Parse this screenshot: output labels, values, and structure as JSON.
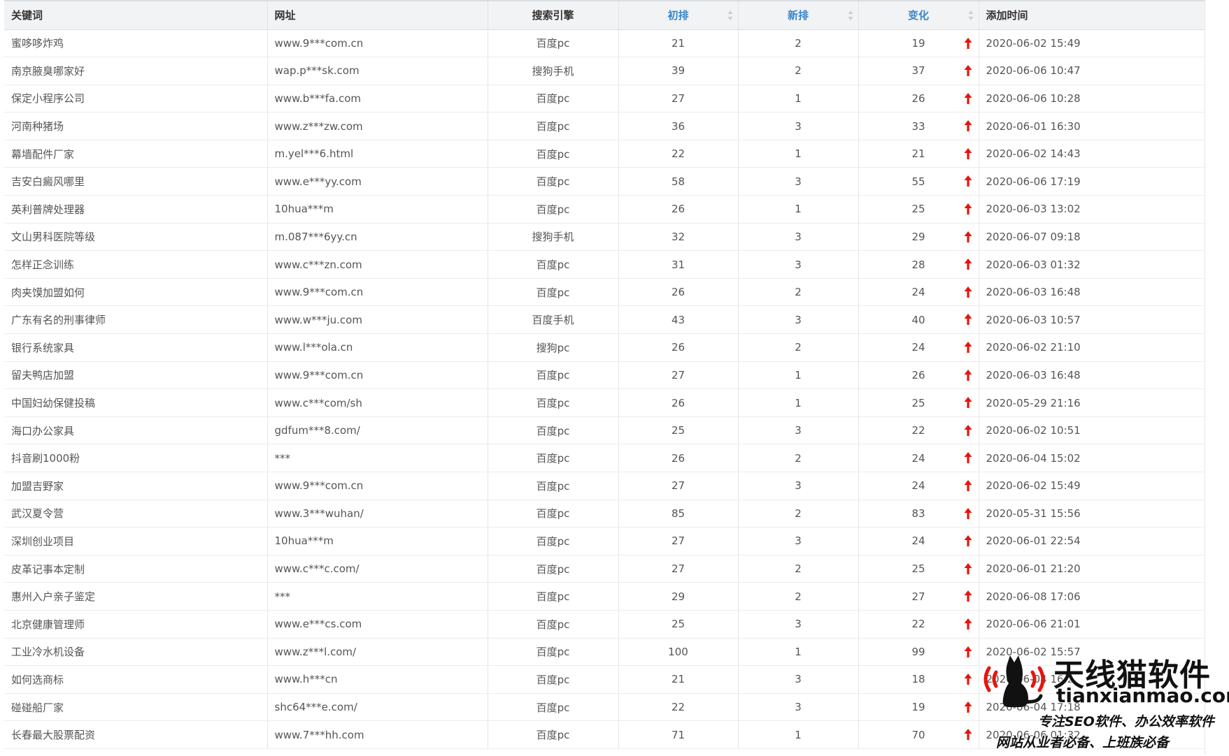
{
  "table": {
    "headers": {
      "keyword": "关键词",
      "url": "网址",
      "engine": "搜索引擎",
      "initial": "初排",
      "new": "新排",
      "change": "变化",
      "added": "添加时间"
    },
    "rows": [
      {
        "keyword": "蜜哆哆炸鸡",
        "url": "www.9***com.cn",
        "engine": "百度pc",
        "initial": "21",
        "new": "2",
        "change": "19",
        "added": "2020-06-02 15:49"
      },
      {
        "keyword": "南京腋臭哪家好",
        "url": "wap.p***sk.com",
        "engine": "搜狗手机",
        "initial": "39",
        "new": "2",
        "change": "37",
        "added": "2020-06-06 10:47"
      },
      {
        "keyword": "保定小程序公司",
        "url": "www.b***fa.com",
        "engine": "百度pc",
        "initial": "27",
        "new": "1",
        "change": "26",
        "added": "2020-06-06 10:28"
      },
      {
        "keyword": "河南种猪场",
        "url": "www.z***zw.com",
        "engine": "百度pc",
        "initial": "36",
        "new": "3",
        "change": "33",
        "added": "2020-06-01 16:30"
      },
      {
        "keyword": "幕墙配件厂家",
        "url": "m.yel***6.html",
        "engine": "百度pc",
        "initial": "22",
        "new": "1",
        "change": "21",
        "added": "2020-06-02 14:43"
      },
      {
        "keyword": "吉安白癜风哪里",
        "url": "www.e***yy.com",
        "engine": "百度pc",
        "initial": "58",
        "new": "3",
        "change": "55",
        "added": "2020-06-06 17:19"
      },
      {
        "keyword": "英利普牌处理器",
        "url": "10hua***m",
        "engine": "百度pc",
        "initial": "26",
        "new": "1",
        "change": "25",
        "added": "2020-06-03 13:02"
      },
      {
        "keyword": "文山男科医院等级",
        "url": "m.087***6yy.cn",
        "engine": "搜狗手机",
        "initial": "32",
        "new": "3",
        "change": "29",
        "added": "2020-06-07 09:18"
      },
      {
        "keyword": "怎样正念训练",
        "url": "www.c***zn.com",
        "engine": "百度pc",
        "initial": "31",
        "new": "3",
        "change": "28",
        "added": "2020-06-03 01:32"
      },
      {
        "keyword": "肉夹馍加盟如何",
        "url": "www.9***com.cn",
        "engine": "百度pc",
        "initial": "26",
        "new": "2",
        "change": "24",
        "added": "2020-06-03 16:48"
      },
      {
        "keyword": "广东有名的刑事律师",
        "url": "www.w***ju.com",
        "engine": "百度手机",
        "initial": "43",
        "new": "3",
        "change": "40",
        "added": "2020-06-03 10:57"
      },
      {
        "keyword": "银行系统家具",
        "url": "www.l***ola.cn",
        "engine": "搜狗pc",
        "initial": "26",
        "new": "2",
        "change": "24",
        "added": "2020-06-02 21:10"
      },
      {
        "keyword": "留夫鸭店加盟",
        "url": "www.9***com.cn",
        "engine": "百度pc",
        "initial": "27",
        "new": "1",
        "change": "26",
        "added": "2020-06-03 16:48"
      },
      {
        "keyword": "中国妇幼保健投稿",
        "url": "www.c***com/sh",
        "engine": "百度pc",
        "initial": "26",
        "new": "1",
        "change": "25",
        "added": "2020-05-29 21:16"
      },
      {
        "keyword": "海口办公家具",
        "url": "gdfum***8.com/",
        "engine": "百度pc",
        "initial": "25",
        "new": "3",
        "change": "22",
        "added": "2020-06-02 10:51"
      },
      {
        "keyword": "抖音刷1000粉",
        "url": "***",
        "engine": "百度pc",
        "initial": "26",
        "new": "2",
        "change": "24",
        "added": "2020-06-04 15:02"
      },
      {
        "keyword": "加盟吉野家",
        "url": "www.9***com.cn",
        "engine": "百度pc",
        "initial": "27",
        "new": "3",
        "change": "24",
        "added": "2020-06-02 15:49"
      },
      {
        "keyword": "武汉夏令营",
        "url": "www.3***wuhan/",
        "engine": "百度pc",
        "initial": "85",
        "new": "2",
        "change": "83",
        "added": "2020-05-31 15:56"
      },
      {
        "keyword": "深圳创业项目",
        "url": "10hua***m",
        "engine": "百度pc",
        "initial": "27",
        "new": "3",
        "change": "24",
        "added": "2020-06-01 22:54"
      },
      {
        "keyword": "皮革记事本定制",
        "url": "www.c***c.com/",
        "engine": "百度pc",
        "initial": "27",
        "new": "2",
        "change": "25",
        "added": "2020-06-01 21:20"
      },
      {
        "keyword": "惠州入户亲子鉴定",
        "url": "***",
        "engine": "百度pc",
        "initial": "29",
        "new": "2",
        "change": "27",
        "added": "2020-06-08 17:06"
      },
      {
        "keyword": "北京健康管理师",
        "url": "www.e***cs.com",
        "engine": "百度pc",
        "initial": "25",
        "new": "3",
        "change": "22",
        "added": "2020-06-06 21:01"
      },
      {
        "keyword": "工业冷水机设备",
        "url": "www.z***l.com/",
        "engine": "百度pc",
        "initial": "100",
        "new": "1",
        "change": "99",
        "added": "2020-06-02 15:57"
      },
      {
        "keyword": "如何选商标",
        "url": "www.h***cn",
        "engine": "百度pc",
        "initial": "21",
        "new": "3",
        "change": "18",
        "added": "2020-06-04 16:2"
      },
      {
        "keyword": "碰碰船厂家",
        "url": "shc64***e.com/",
        "engine": "百度pc",
        "initial": "22",
        "new": "3",
        "change": "19",
        "added": "2020-06-04 17:18"
      },
      {
        "keyword": "长春最大股票配资",
        "url": "www.7***hh.com",
        "engine": "百度pc",
        "initial": "71",
        "new": "1",
        "change": "70",
        "added": "2020-06-06 01:32"
      }
    ]
  },
  "watermark": {
    "brand": "天线猫软件",
    "domain": "tianxianmao.com",
    "tagline1": "专注SEO软件、办公效率软件",
    "tagline2": "网站从业者必备、上班族必备"
  },
  "icons": {
    "sort": "sort-icon",
    "change": "arrow-up-icon",
    "logo": "cat-antenna-icon"
  },
  "colors": {
    "header_bg": "#f2f3f5",
    "sortable_header_text": "#3a86c8",
    "up_arrow": "#e8140c",
    "body_text": "#555555"
  }
}
